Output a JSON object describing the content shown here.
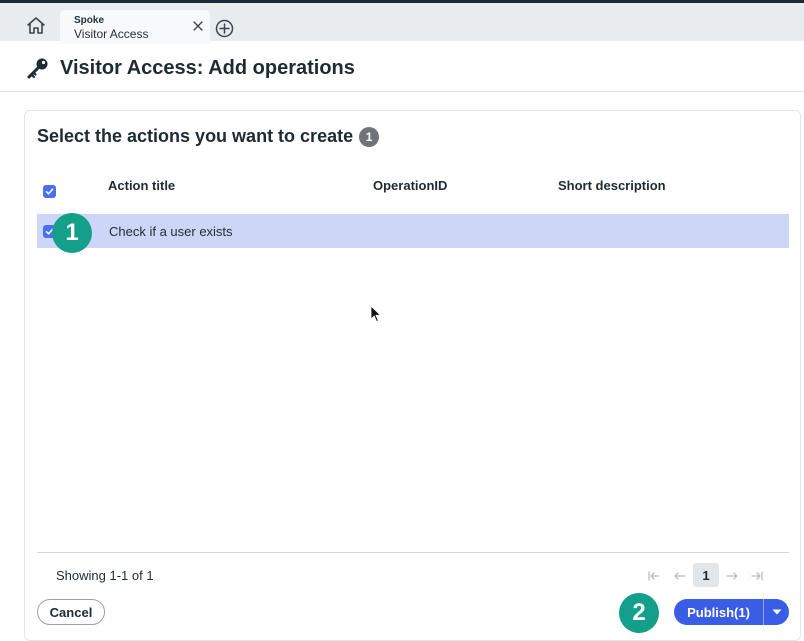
{
  "tabs": [
    {
      "kicker": "Spoke",
      "label": "Visitor Access"
    }
  ],
  "header": {
    "title": "Visitor Access: Add operations"
  },
  "card": {
    "title": "Select the actions you want to create",
    "selected_count": "1"
  },
  "table": {
    "columns": [
      "Action title",
      "OperationID",
      "Short description"
    ],
    "rows": [
      {
        "title": "Check if a user exists",
        "operation_id": "",
        "short_description": "",
        "checked": true
      }
    ]
  },
  "pagination": {
    "summary": "Showing 1-1 of 1",
    "current_page": "1"
  },
  "footer": {
    "cancel_label": "Cancel",
    "publish_label": "Publish(1)"
  },
  "step_markers": [
    "1",
    "2"
  ],
  "colors": {
    "accent": "#3a5de6",
    "selected_row": "#cdd6f7",
    "step_marker": "#149f8a",
    "badge": "#6e7479"
  },
  "icons": [
    "home-icon",
    "close-icon",
    "add-tab-icon",
    "key-icon",
    "check-icon",
    "first-page-icon",
    "prev-page-icon",
    "next-page-icon",
    "last-page-icon",
    "caret-down-icon",
    "mouse-cursor-icon"
  ]
}
